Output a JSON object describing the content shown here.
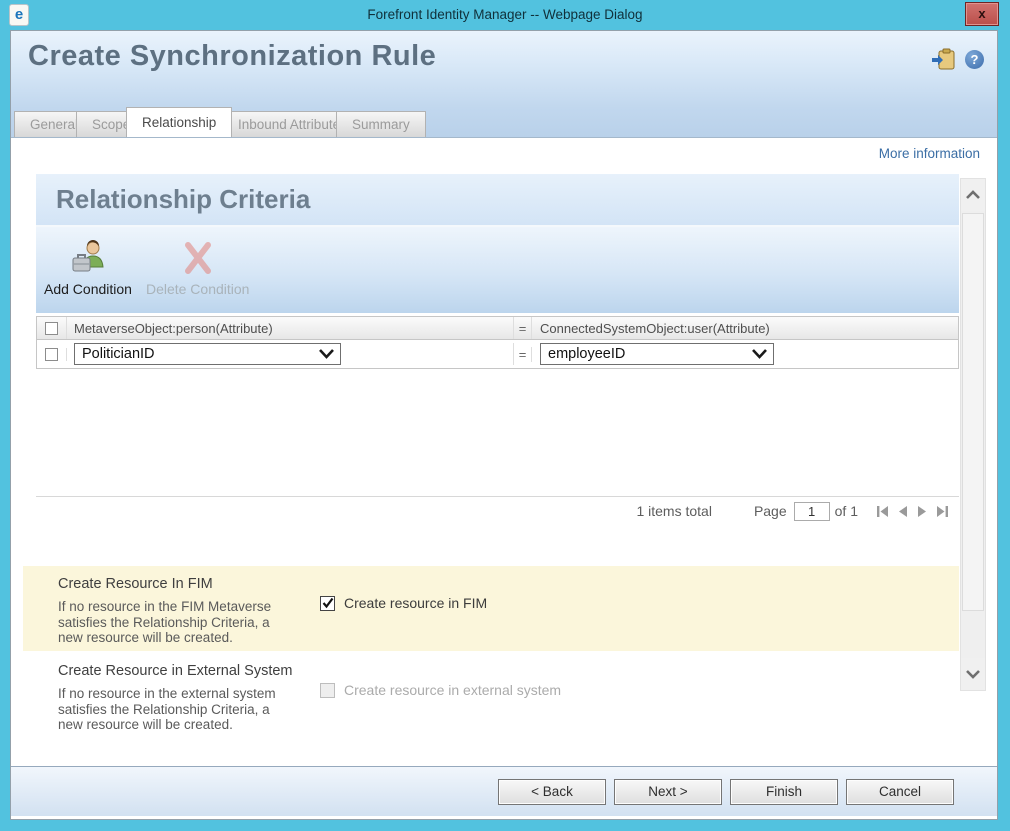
{
  "window": {
    "title": "Forefront Identity Manager -- Webpage Dialog",
    "close_glyph": "x",
    "ie_glyph": "e"
  },
  "header": {
    "title": "Create Synchronization Rule",
    "help_glyph": "?",
    "more_information": "More information"
  },
  "tabs": [
    {
      "label": "General",
      "active": false
    },
    {
      "label": "Scope",
      "active": false
    },
    {
      "label": "Relationship",
      "active": true
    },
    {
      "label": "Inbound Attribute Flow",
      "active": false
    },
    {
      "label": "Summary",
      "active": false
    }
  ],
  "criteria": {
    "title": "Relationship Criteria",
    "toolbar": {
      "add_label": "Add Condition",
      "delete_label": "Delete Condition",
      "delete_disabled": true
    },
    "table": {
      "header_left": "MetaverseObject:person(Attribute)",
      "operator": "=",
      "header_right": "ConnectedSystemObject:user(Attribute)",
      "row": {
        "left_value": "PoliticianID",
        "operator": "=",
        "right_value": "employeeID"
      }
    },
    "pagination": {
      "items_total": "1 items total",
      "page_label": "Page",
      "page_value": "1",
      "of_label": "of 1"
    }
  },
  "create_in_fim": {
    "title": "Create Resource In FIM",
    "description": "If no resource in the FIM Metaverse satisfies the Relationship Criteria, a new resource will be created.",
    "checkbox_label": "Create resource in FIM",
    "checked": true
  },
  "create_external": {
    "title": "Create Resource in External System",
    "description": "If no resource in the external system satisfies the Relationship Criteria, a new resource will be created.",
    "checkbox_label": "Create resource in external system",
    "checked": false,
    "disabled": true
  },
  "footer": {
    "back_label": "< Back",
    "next_label": "Next >",
    "finish_label": "Finish",
    "cancel_label": "Cancel"
  },
  "colors": {
    "titlebar_cyan": "#52c2df",
    "close_red": "#bb4f4b",
    "header_gradient_top": "#eaf3fc",
    "header_gradient_bottom": "#c1d7ee",
    "heading_slate": "#5d7081",
    "link_blue": "#3b6ea5",
    "highlight_yellow": "#fbf6db"
  }
}
